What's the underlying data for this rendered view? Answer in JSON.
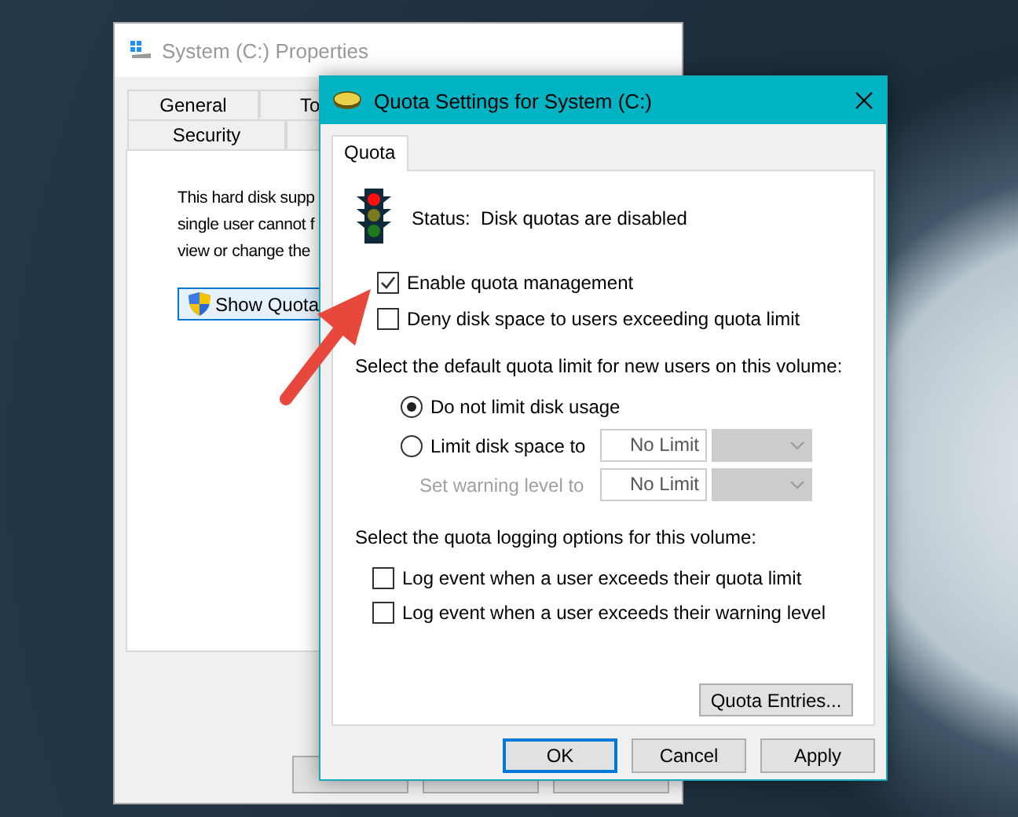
{
  "back_window": {
    "title": "System (C:) Properties",
    "tabs": [
      {
        "label": "General"
      },
      {
        "label": "To"
      },
      {
        "label": "Security"
      }
    ],
    "description_lines": [
      "This hard disk supp",
      "single user cannot f",
      "view or change the"
    ],
    "show_quota_button": "Show Quota"
  },
  "dialog": {
    "title": "Quota Settings for System (C:)",
    "tabs": [
      {
        "label": "Quota",
        "selected": true
      }
    ],
    "status": {
      "label": "Status:",
      "value": "Disk quotas are disabled"
    },
    "options": [
      {
        "label": "Enable quota management",
        "checked": true
      },
      {
        "label": "Deny disk space to users exceeding quota limit",
        "checked": false
      }
    ],
    "limit_heading": "Select the default quota limit for new users on this volume:",
    "limit_choices": [
      {
        "label": "Do not limit disk usage",
        "selected": true
      },
      {
        "label": "Limit disk space to",
        "selected": false,
        "value": "No Limit"
      }
    ],
    "warning": {
      "label": "Set warning level to",
      "value": "No Limit",
      "disabled": true
    },
    "logging_heading": "Select the quota logging options for this volume:",
    "logging_options": [
      {
        "label": "Log event when a user exceeds their quota limit",
        "checked": false
      },
      {
        "label": "Log event when a user exceeds their warning level",
        "checked": false
      }
    ],
    "entries_button": "Quota Entries...",
    "buttons": [
      {
        "label": "OK",
        "default": true
      },
      {
        "label": "Cancel",
        "default": false
      },
      {
        "label": "Apply",
        "default": false
      }
    ]
  }
}
